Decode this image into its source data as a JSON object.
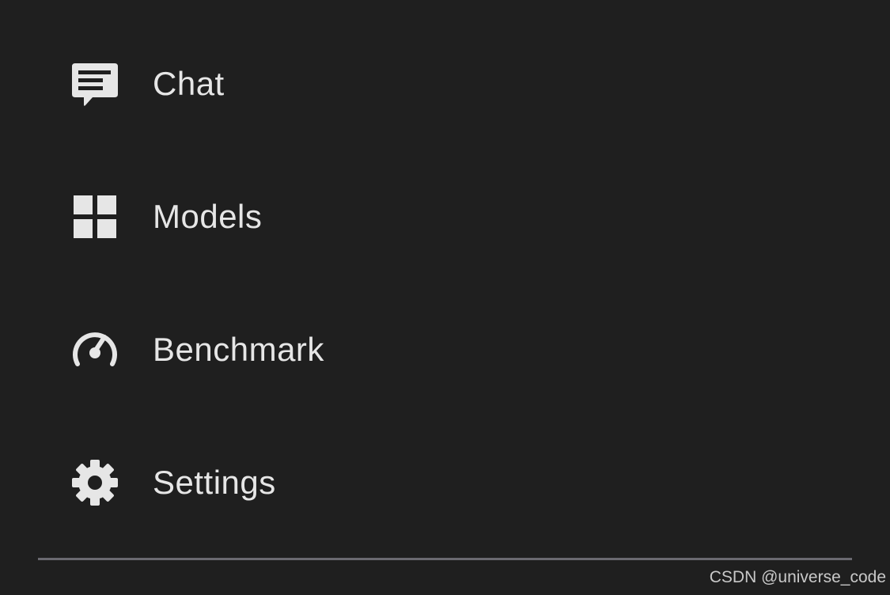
{
  "nav": {
    "items": [
      {
        "label": "Chat",
        "icon": "chat-icon"
      },
      {
        "label": "Models",
        "icon": "grid-icon"
      },
      {
        "label": "Benchmark",
        "icon": "speedometer-icon"
      },
      {
        "label": "Settings",
        "icon": "gear-icon"
      }
    ]
  },
  "watermark": "CSDN @universe_code",
  "colors": {
    "background": "#1f1f1f",
    "text": "#e6e6e6",
    "divider": "#6b6a70"
  }
}
